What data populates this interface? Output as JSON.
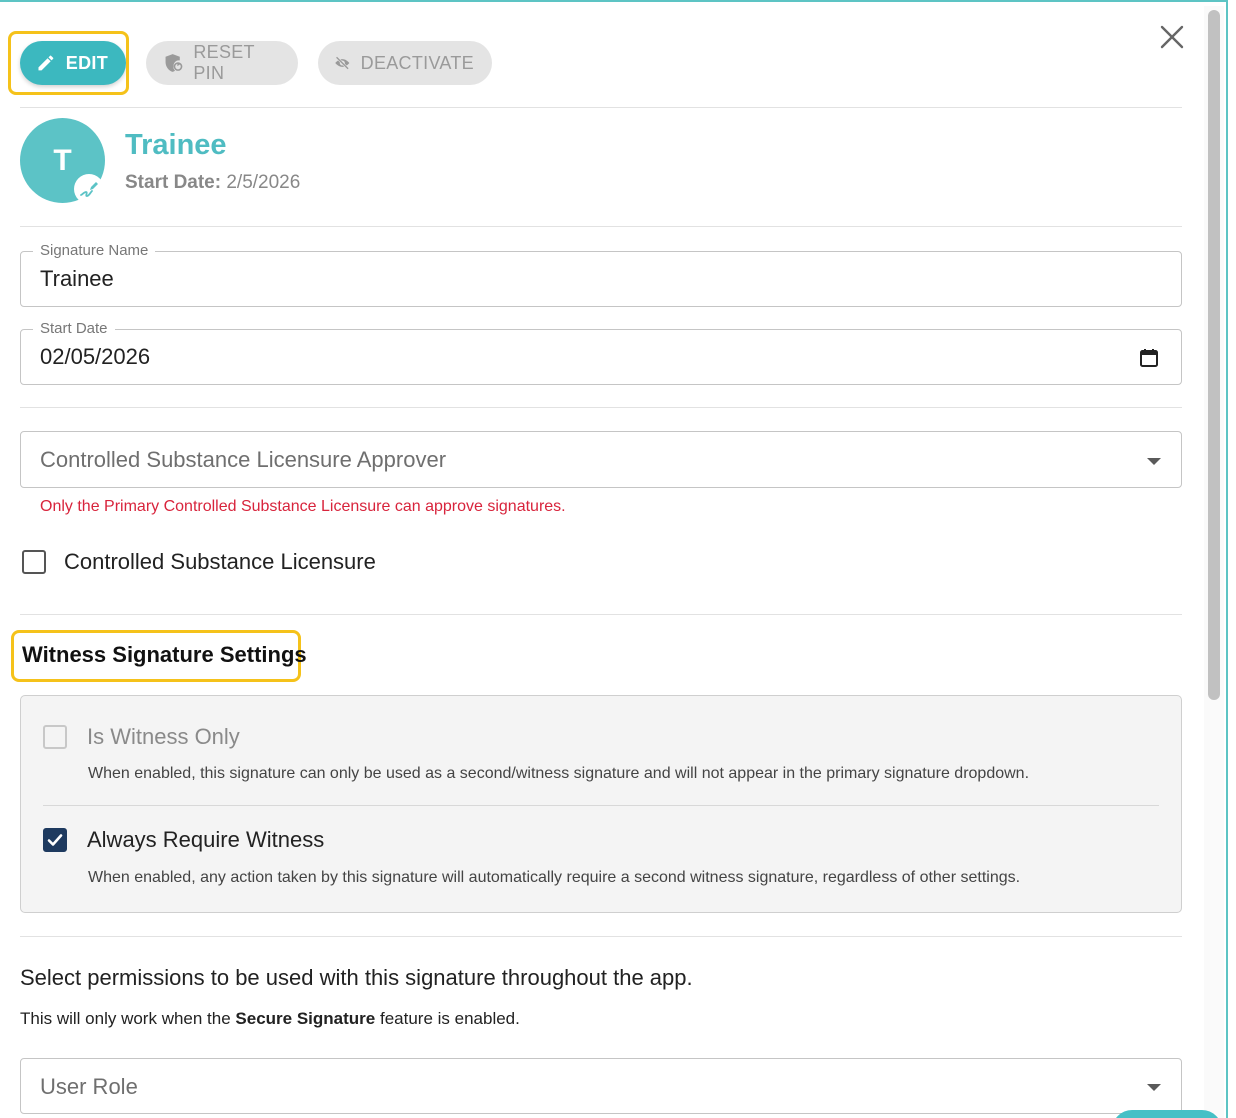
{
  "toolbar": {
    "edit_label": "EDIT",
    "reset_pin_label": "RESET PIN",
    "deactivate_label": "DEACTIVATE"
  },
  "profile": {
    "avatar_initial": "T",
    "name": "Trainee",
    "start_date_label": "Start Date:",
    "start_date_value": "2/5/2026"
  },
  "form": {
    "signature_name": {
      "label": "Signature Name",
      "value": "Trainee"
    },
    "start_date": {
      "label": "Start Date",
      "value": "02/05/2026"
    },
    "approver_select": {
      "placeholder": "Controlled Substance Licensure Approver"
    },
    "approver_error": "Only the Primary Controlled Substance Licensure can approve signatures.",
    "controlled_substance": {
      "label": "Controlled Substance Licensure",
      "checked": false
    }
  },
  "witness": {
    "section_title": "Witness Signature Settings",
    "is_witness_only": {
      "label": "Is Witness Only",
      "description": "When enabled, this signature can only be used as a second/witness signature and will not appear in the primary signature dropdown.",
      "checked": false,
      "disabled": true
    },
    "always_require": {
      "label": "Always Require Witness",
      "description": "When enabled, any action taken by this signature will automatically require a second witness signature, regardless of other settings.",
      "checked": true
    }
  },
  "permissions": {
    "heading": "Select permissions to be used with this signature throughout the app.",
    "note_prefix": "This will only work when the ",
    "note_bold": "Secure Signature",
    "note_suffix": " feature is enabled.",
    "user_role_placeholder": "User Role"
  },
  "icons": {
    "edit": "pencil-icon",
    "reset_pin": "shield-refresh-icon",
    "deactivate": "eye-off-icon",
    "close": "close-icon",
    "calendar": "calendar-icon",
    "avatar_badge": "signature-icon"
  },
  "colors": {
    "accent": "#3cb8bf",
    "name_color": "#4fbcc2",
    "error": "#d8243c",
    "highlight": "#f5c21a",
    "checkbox_checked": "#1e3a5f"
  }
}
